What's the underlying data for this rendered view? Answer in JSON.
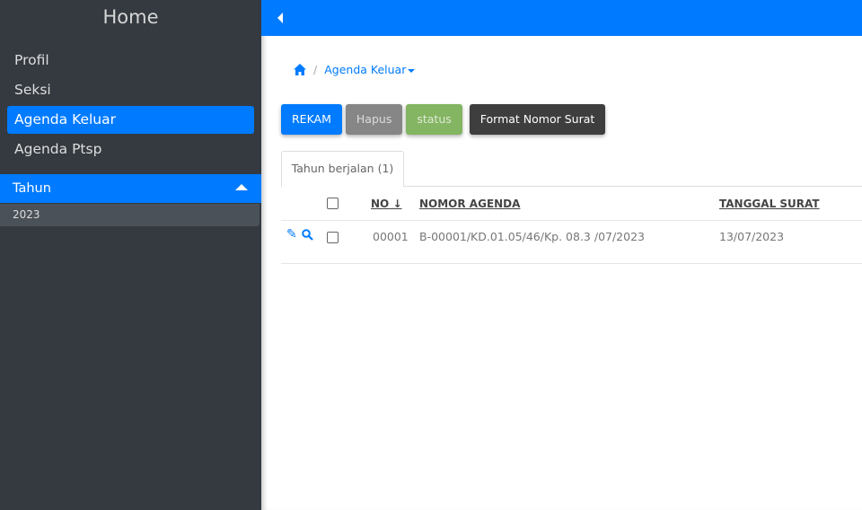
{
  "sidebar": {
    "home": "Home",
    "items": [
      {
        "label": "Profil"
      },
      {
        "label": "Seksi"
      },
      {
        "label": "Agenda Keluar",
        "active": true
      },
      {
        "label": "Agenda Ptsp"
      }
    ],
    "group": {
      "label": "Tahun",
      "items": [
        "2023"
      ]
    }
  },
  "breadcrumb": {
    "current": "Agenda Keluar"
  },
  "toolbar": {
    "rekam": "REKAM",
    "hapus": "Hapus",
    "status": "status",
    "format": "Format Nomor Surat"
  },
  "tabs": [
    {
      "label": "Tahun berjalan (1)"
    }
  ],
  "table": {
    "headers": {
      "no": "NO",
      "nomor": "NOMOR AGENDA",
      "tanggal": "TANGGAL SURAT"
    },
    "rows": [
      {
        "no": "00001",
        "nomor": "B-00001/KD.01.05/46/Kp. 08.3 /07/2023",
        "tanggal": "13/07/2023"
      }
    ]
  },
  "colors": {
    "primary": "#007bff",
    "sidebar": "#343a40"
  }
}
